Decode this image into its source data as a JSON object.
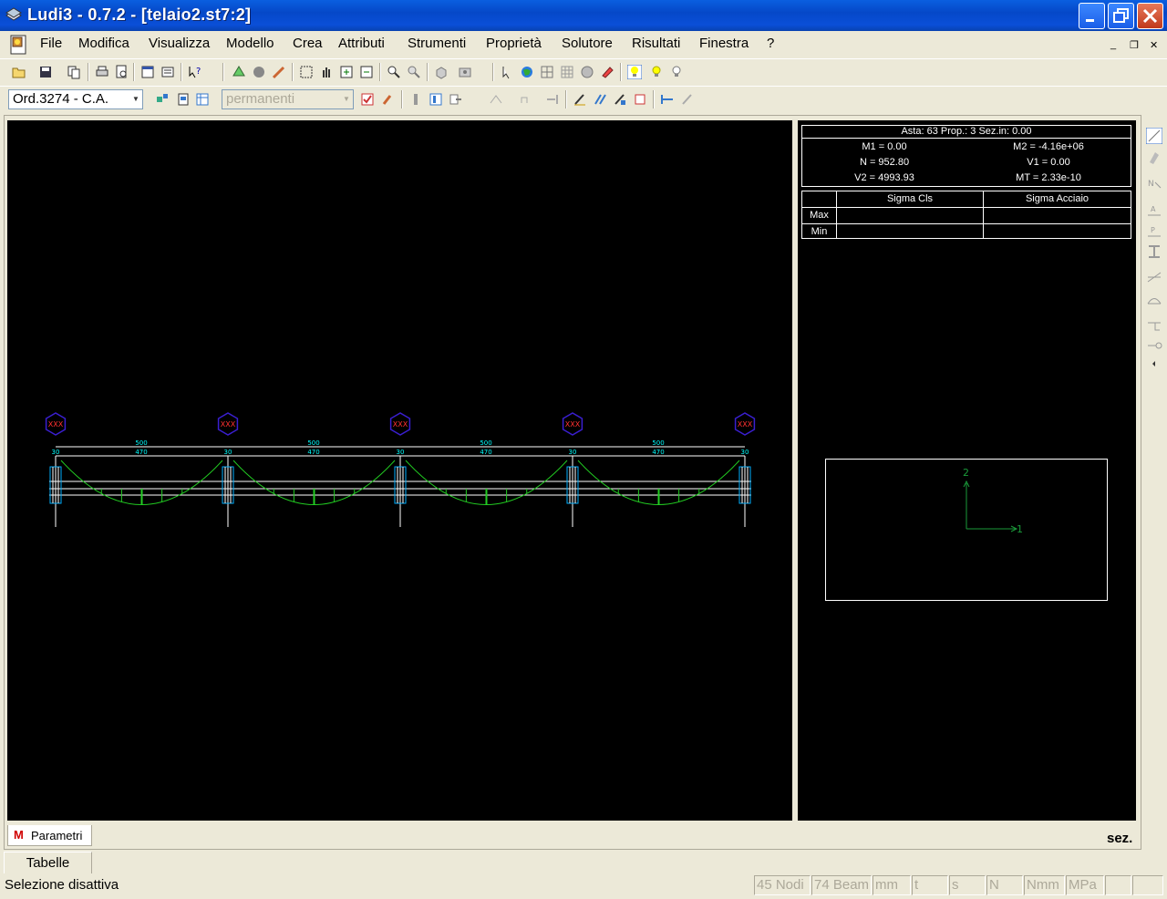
{
  "window": {
    "title": "Ludi3 - 0.7.2 - [telaio2.st7:2]",
    "minimize": "0",
    "maximize": "1",
    "close": "r"
  },
  "menu": {
    "items": [
      "File",
      "Modifica",
      "Visualizza",
      "Modello",
      "Crea",
      "Attributi",
      "Strumenti",
      "Proprietà",
      "Solutore",
      "Risultati",
      "Finestra",
      "?"
    ],
    "mdi_minimize": "_",
    "mdi_restore": "❐",
    "mdi_close": "✕"
  },
  "toolbar2": {
    "norm_combo": "Ord.3274 - C.A.",
    "load_combo": "permanenti"
  },
  "info": {
    "header": "Asta: 63  Prop.: 3  Sez.in: 0.00",
    "m1": "M1 = 0.00",
    "m2": "M2 = -4.16e+06",
    "n": "N = 952.80",
    "v1": "V1 = 0.00",
    "v2": "V2 = 4993.93",
    "mt": "MT = 2.33e-10"
  },
  "sigma": {
    "col1": "Sigma Cls",
    "col2": "Sigma Acciaio",
    "row1": "Max",
    "row2": "Min"
  },
  "section_axes": {
    "axis2": "2",
    "axis1": "1"
  },
  "frame": {
    "node_label": "XXX",
    "span_labels": [
      "500",
      "500",
      "500",
      "500"
    ],
    "clear_labels": [
      "470",
      "470",
      "470",
      "470"
    ],
    "column_labels": [
      "30",
      "30",
      "30",
      "30",
      "30"
    ]
  },
  "tabs": {
    "parametri": "Parametri",
    "sez": "sez.",
    "tabelle": "Tabelle"
  },
  "status": {
    "main": "Selezione disattiva",
    "nodes": "45 Nodi",
    "beams": "74 Beam",
    "units": [
      "mm",
      "t",
      "s",
      "N",
      "Nmm",
      "MPa",
      "",
      ""
    ]
  },
  "colors": {
    "canvas_bg": "#000000",
    "beam_line": "#ffffff",
    "moment_diagram": "#22cc22",
    "column": "#00b0ff",
    "node_marker": "#3a1fd0",
    "node_text": "#ff3030",
    "dim_text": "#00ffff"
  }
}
